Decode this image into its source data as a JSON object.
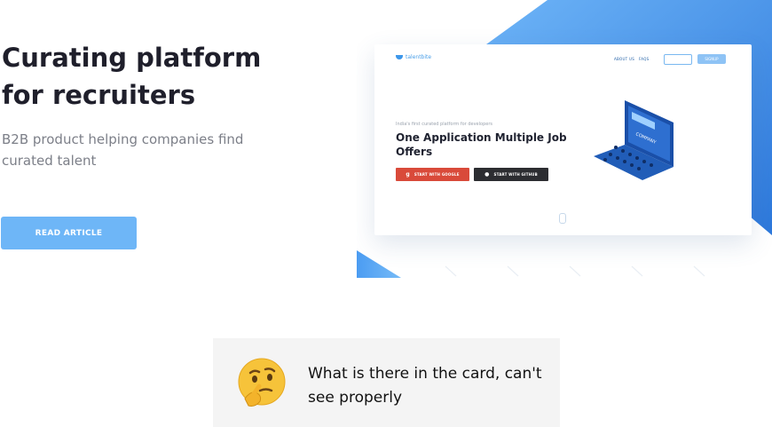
{
  "hero": {
    "title": "Curating platform for recruiters",
    "subtitle": "B2B product helping companies find curated talent",
    "button_label": "READ ARTICLE"
  },
  "preview": {
    "logo_text": "talentbite",
    "nav": [
      "ABOUT US",
      "FAQS"
    ],
    "login_label": "LOGIN ▾",
    "signup_label": "SIGNUP",
    "tagline": "India's first curated platform for developers",
    "headline": "One Application Multiple Job Offers",
    "google_button": "START WITH GOOGLE",
    "github_button": "START WITH GITHUB",
    "illustration_label": "COMPANY"
  },
  "note": {
    "emoji": "thinking-face",
    "text": "What is there in the card, can't see properly"
  },
  "colors": {
    "accent_blue": "#3d8ef0",
    "button_blue": "#6eb6f7",
    "google_red": "#d94a3a",
    "github_dark": "#2c2d31",
    "title_dark": "#1f1f2b",
    "note_bg": "#f4f4f4"
  }
}
